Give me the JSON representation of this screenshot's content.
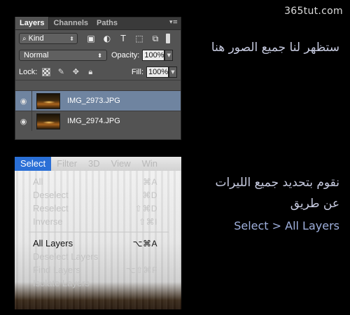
{
  "watermark": "365tut.com",
  "layers_panel": {
    "tabs": [
      "Layers",
      "Channels",
      "Paths"
    ],
    "filter_label": "Kind",
    "blend_mode": "Normal",
    "opacity_label": "Opacity:",
    "opacity_value": "100%",
    "lock_label": "Lock:",
    "fill_label": "Fill:",
    "fill_value": "100%",
    "layers": [
      {
        "name": "IMG_2973.JPG",
        "selected": true
      },
      {
        "name": "IMG_2974.JPG",
        "selected": false
      }
    ]
  },
  "menu": {
    "menubar": [
      "Select",
      "Filter",
      "3D",
      "View",
      "Win"
    ],
    "items": [
      {
        "label": "All",
        "shortcut": "⌘A",
        "enabled": false
      },
      {
        "label": "Deselect",
        "shortcut": "⌘D",
        "enabled": false
      },
      {
        "label": "Reselect",
        "shortcut": "⇧⌘D",
        "enabled": false
      },
      {
        "label": "Inverse",
        "shortcut": "⇧⌘I",
        "enabled": false
      },
      {
        "label": "All Layers",
        "shortcut": "⌥⌘A",
        "enabled": true
      },
      {
        "label": "Deselect Layers",
        "shortcut": "",
        "enabled": false
      },
      {
        "label": "Find Layers",
        "shortcut": "⌥⇧⌘F",
        "enabled": false
      },
      {
        "label": "Isolate Layers",
        "shortcut": "",
        "enabled": false
      }
    ]
  },
  "captions": {
    "line1": "ستظهر لنا جميع الصور هنا",
    "line2a": "نقوم بتحديد جميع الليرات",
    "line2b": "عن طريق",
    "line3": "Select > All Layers"
  }
}
